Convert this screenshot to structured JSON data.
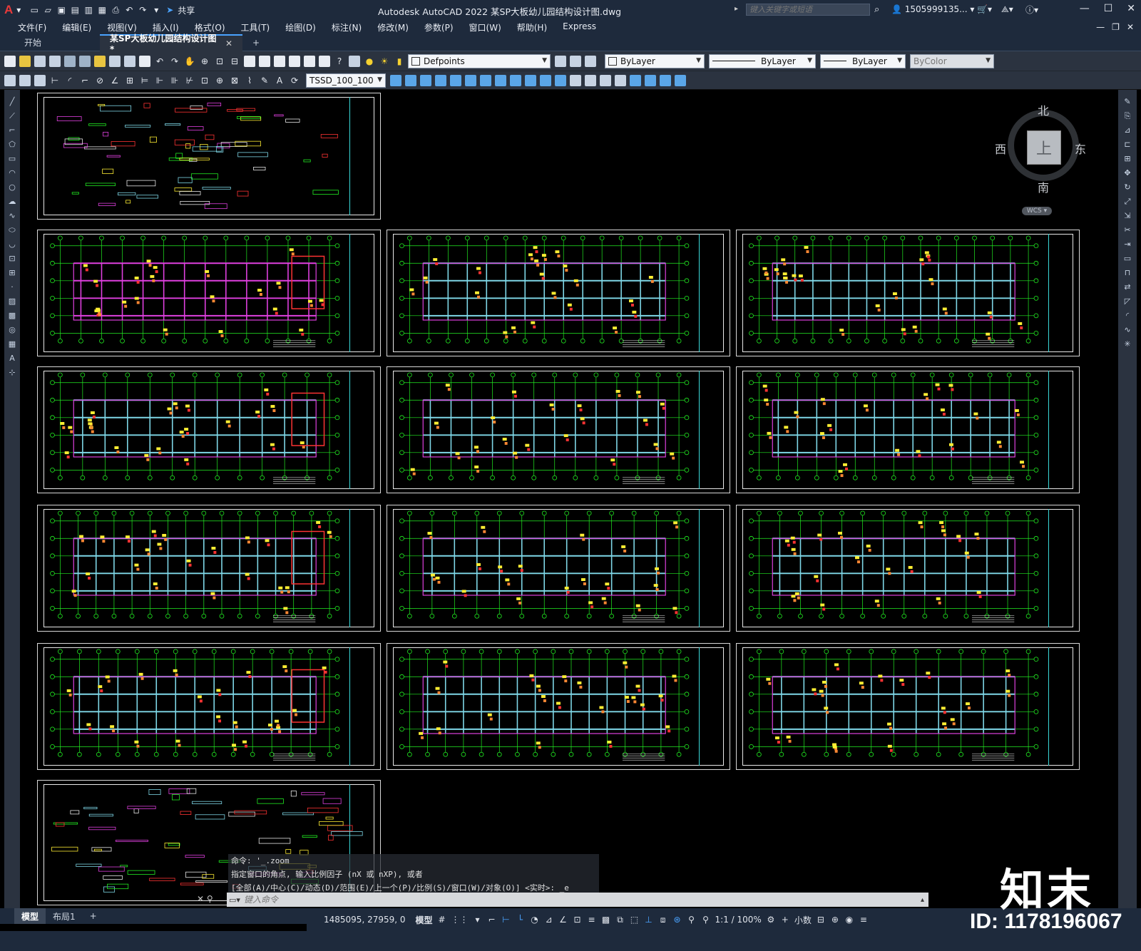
{
  "app": {
    "logo": "A",
    "title": "Autodesk AutoCAD 2022    某SP大板幼儿园结构设计图.dwg",
    "search_placeholder": "键入关键字或短语",
    "user": "1505999135...",
    "share": "共享"
  },
  "menu": [
    "文件(F)",
    "编辑(E)",
    "视图(V)",
    "插入(I)",
    "格式(O)",
    "工具(T)",
    "绘图(D)",
    "标注(N)",
    "修改(M)",
    "参数(P)",
    "窗口(W)",
    "帮助(H)",
    "Express"
  ],
  "tabs": {
    "start": "开始",
    "drawing": "某SP大板幼儿园结构设计图*",
    "add": "+"
  },
  "toolbar": {
    "layer": "Defpoints",
    "color": "ByLayer",
    "linetype": "ByLayer",
    "lineweight": "ByLayer",
    "plotstyle": "ByColor",
    "dimstyle": "TSSD_100_100"
  },
  "viewcube": {
    "north": "北",
    "south": "南",
    "east": "东",
    "west": "西",
    "face": "上",
    "wcs": "WCS"
  },
  "command": {
    "history": [
      "命令:  '_.zoom",
      "指定窗口的角点, 输入比例因子 (nX 或 nXP), 或者",
      "[全部(A)/中心(C)/动态(D)/范围(E)/上一个(P)/比例(S)/窗口(W)/对象(O)] <实时>: _e"
    ],
    "placeholder": "键入命令"
  },
  "layout_tabs": [
    "模型",
    "布局1",
    "+"
  ],
  "status": {
    "coords": "1485095, 27959, 0",
    "model": "模型",
    "scale": "1:1 / 100%",
    "units": "小数"
  },
  "watermark": {
    "logo": "知末",
    "id": "ID: 1178196067"
  },
  "colors": {
    "background": "#000000",
    "grid_green": "#22ee22",
    "wall_cyan": "#7fd8e8",
    "wall_magenta": "#e040e0",
    "wall_red": "#ff3333",
    "tag_yellow": "#ffee33",
    "border_white": "#e8e8e8"
  }
}
